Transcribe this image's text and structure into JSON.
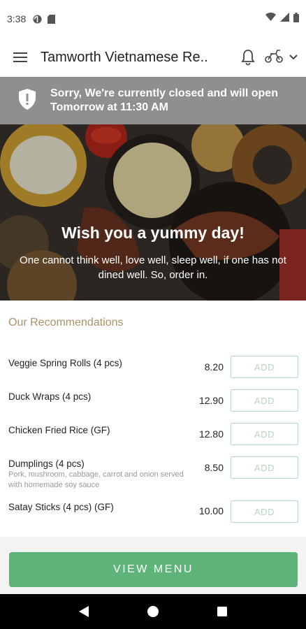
{
  "status_bar": {
    "time": "3:38"
  },
  "app_bar": {
    "title": "Tamworth Vietnamese Re..",
    "menu_icon": "hamburger-menu-icon",
    "bell_icon": "bell-icon",
    "delivery_icon": "scooter-icon",
    "chevron_icon": "chevron-down-icon"
  },
  "closed_banner": {
    "icon": "shield-alert-icon",
    "line1": "Sorry, We're currently closed and will open",
    "line2": "Tomorrow at 11:30 AM"
  },
  "hero": {
    "title": "Wish you a yummy day!",
    "subtitle": "One cannot think well, love well, sleep well, if one has not dined well. So, order in."
  },
  "recommendations": {
    "title": "Our Recommendations",
    "add_label": "ADD",
    "items": [
      {
        "name": "Veggie Spring Rolls (4 pcs)",
        "price": "8.20",
        "description": ""
      },
      {
        "name": "Duck Wraps (4 pcs)",
        "price": "12.90",
        "description": ""
      },
      {
        "name": "Chicken Fried Rice (GF)",
        "price": "12.80",
        "description": ""
      },
      {
        "name": "Dumplings (4 pcs)",
        "price": "8.50",
        "description": "Pork, mushroom, cabbage, carrot and onion served with homemade soy sauce"
      },
      {
        "name": "Satay Sticks (4 pcs) (GF)",
        "price": "10.00",
        "description": ""
      }
    ]
  },
  "view_menu_label": "VIEW MENU",
  "colors": {
    "accent_green": "#5eb37a",
    "banner_gray": "#8f8f8f",
    "section_title": "#a9936a"
  }
}
